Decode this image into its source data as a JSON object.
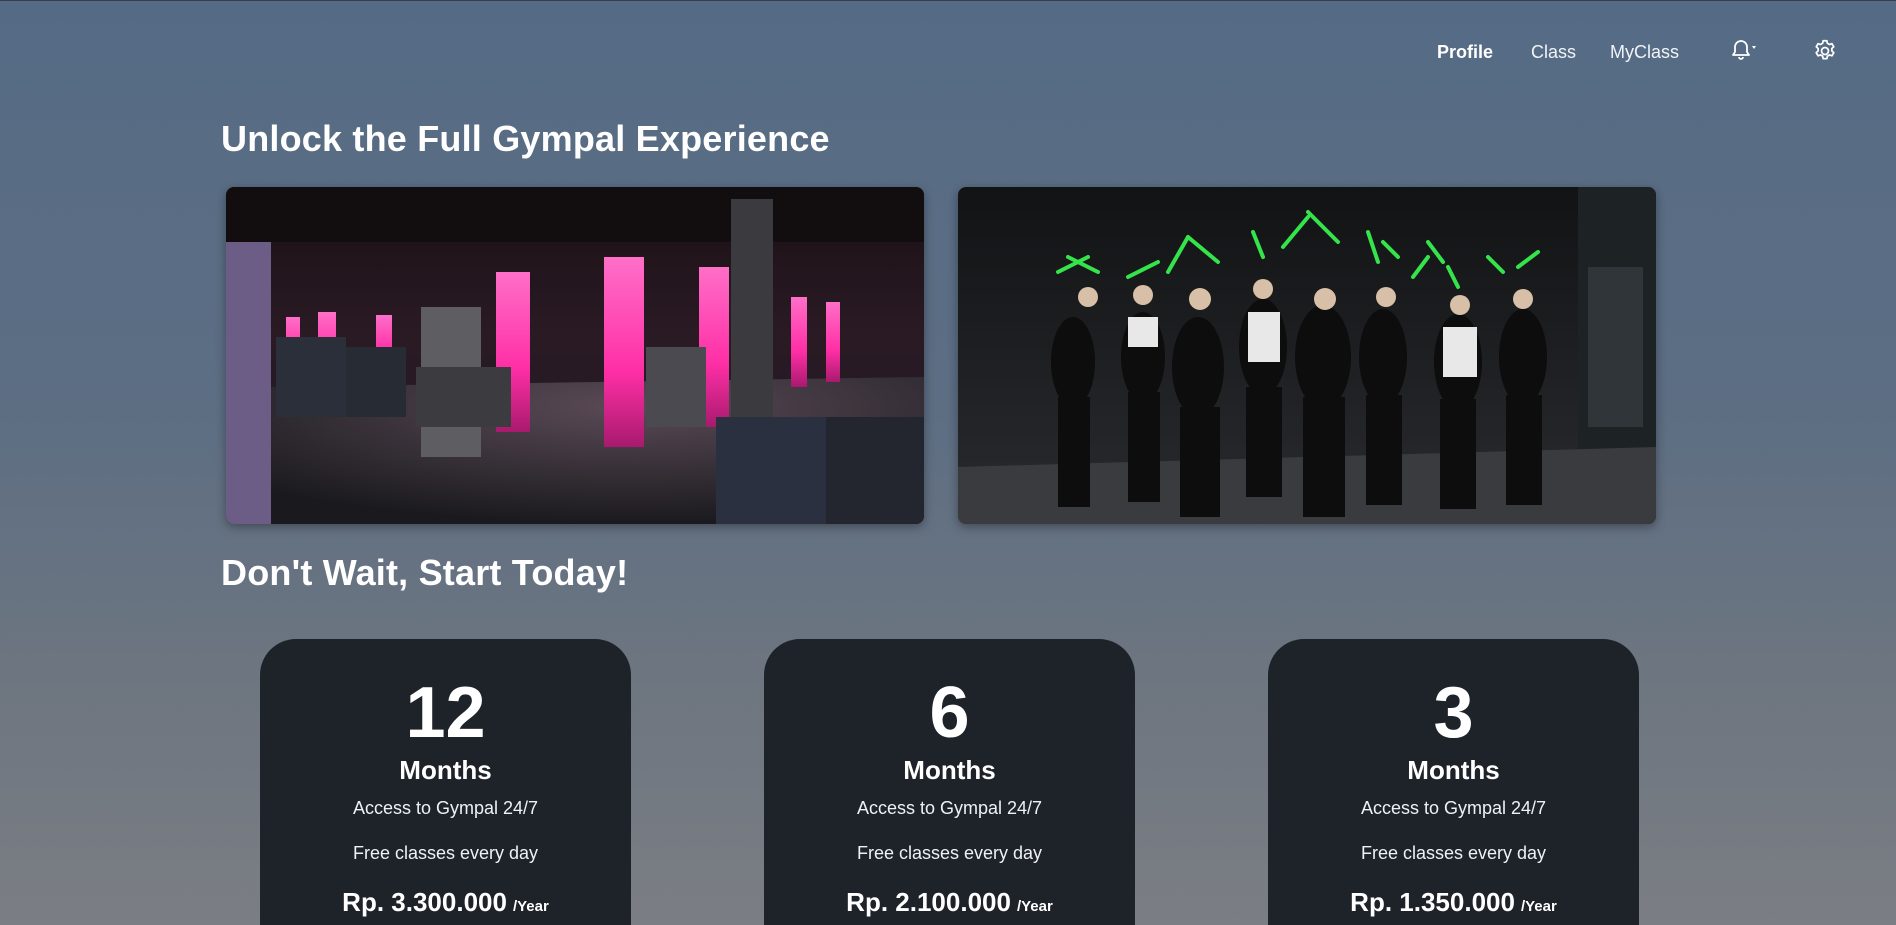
{
  "nav": {
    "profile": "Profile",
    "class": "Class",
    "myclass": "MyClass",
    "notification_icon": "bell-icon",
    "settings_icon": "gear-icon"
  },
  "headings": {
    "unlock": "Unlock the Full Gympal Experience",
    "start": "Don't Wait, Start Today!"
  },
  "images": [
    {
      "alt": "gym-floor-photo"
    },
    {
      "alt": "fitness-class-photo"
    }
  ],
  "plans": [
    {
      "duration": "12",
      "unit": "Months",
      "feature1": "Access to Gympal 24/7",
      "feature2": "Free classes every day",
      "price": "Rp. 3.300.000",
      "period": "/Year"
    },
    {
      "duration": "6",
      "unit": "Months",
      "feature1": "Access to Gympal 24/7",
      "feature2": "Free classes every day",
      "price": "Rp. 2.100.000",
      "period": "/Year"
    },
    {
      "duration": "3",
      "unit": "Months",
      "feature1": "Access to Gympal 24/7",
      "feature2": "Free classes every day",
      "price": "Rp. 1.350.000",
      "period": "/Year"
    }
  ],
  "colors": {
    "card_bg": "#1e232a",
    "page_top": "#556b85",
    "page_bottom": "#7b7e84",
    "accent_pink": "#ff2fa6",
    "accent_green": "#35e34a"
  }
}
